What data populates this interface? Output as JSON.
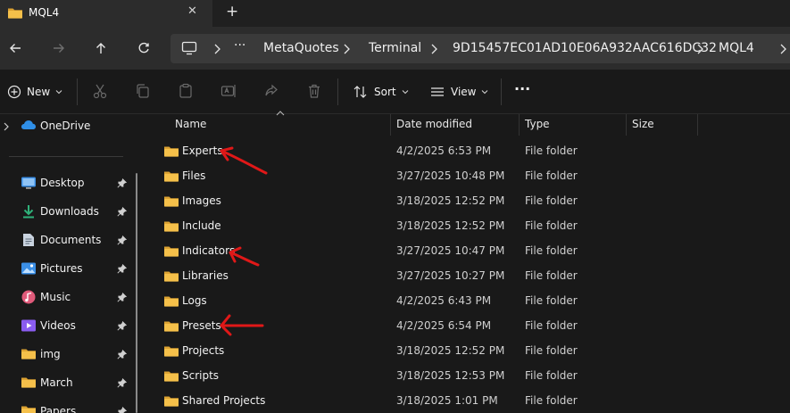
{
  "window": {
    "tab_title": "MQL4",
    "close_glyph": "✕",
    "new_tab_glyph": "+"
  },
  "breadcrumb": {
    "more_glyph": "···",
    "items": [
      "MetaQuotes",
      "Terminal",
      "9D15457EC01AD10E06A932AAC616DC32",
      "MQL4"
    ]
  },
  "toolbar": {
    "new_label": "New",
    "sort_label": "Sort",
    "view_label": "View",
    "more_glyph": "···"
  },
  "sidebar": {
    "onedrive": "OneDrive",
    "items": [
      {
        "label": "Desktop",
        "icon": "desktop-icon"
      },
      {
        "label": "Downloads",
        "icon": "downloads-icon"
      },
      {
        "label": "Documents",
        "icon": "documents-icon"
      },
      {
        "label": "Pictures",
        "icon": "pictures-icon"
      },
      {
        "label": "Music",
        "icon": "music-icon"
      },
      {
        "label": "Videos",
        "icon": "videos-icon"
      },
      {
        "label": "img",
        "icon": "folder-icon"
      },
      {
        "label": "March",
        "icon": "folder-icon"
      },
      {
        "label": "Papers",
        "icon": "folder-icon"
      }
    ]
  },
  "columns": {
    "name": "Name",
    "date": "Date modified",
    "type": "Type",
    "size": "Size"
  },
  "files": [
    {
      "name": "Experts",
      "date": "4/2/2025 6:53 PM",
      "type": "File folder"
    },
    {
      "name": "Files",
      "date": "3/27/2025 10:48 PM",
      "type": "File folder"
    },
    {
      "name": "Images",
      "date": "3/18/2025 12:52 PM",
      "type": "File folder"
    },
    {
      "name": "Include",
      "date": "3/18/2025 12:52 PM",
      "type": "File folder"
    },
    {
      "name": "Indicators",
      "date": "3/27/2025 10:47 PM",
      "type": "File folder"
    },
    {
      "name": "Libraries",
      "date": "3/27/2025 10:27 PM",
      "type": "File folder"
    },
    {
      "name": "Logs",
      "date": "4/2/2025 6:43 PM",
      "type": "File folder"
    },
    {
      "name": "Presets",
      "date": "4/2/2025 6:54 PM",
      "type": "File folder"
    },
    {
      "name": "Projects",
      "date": "3/18/2025 12:52 PM",
      "type": "File folder"
    },
    {
      "name": "Scripts",
      "date": "3/18/2025 12:53 PM",
      "type": "File folder"
    },
    {
      "name": "Shared Projects",
      "date": "3/18/2025 1:01 PM",
      "type": "File folder"
    }
  ],
  "annotations": {
    "color": "#e01818",
    "arrows_point_to": [
      "Experts",
      "Indicators",
      "Presets"
    ]
  },
  "colors": {
    "folder": "#f5c04a",
    "folder_dark": "#dca232",
    "onedrive": "#2f8fe8",
    "accent_blue": "#3b8fe6"
  }
}
